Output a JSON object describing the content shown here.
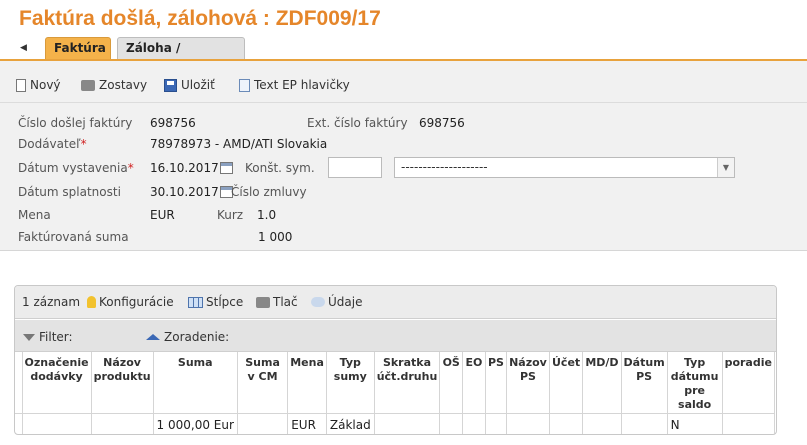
{
  "page": {
    "title": "Faktúra došlá, zálohová :  ZDF009/17",
    "back_glyph": "◀",
    "tabs": [
      "Faktúra",
      "Záloha / Dobropis"
    ]
  },
  "toolbar": {
    "new": "Nový",
    "reports": "Zostavy",
    "save": "Uložiť",
    "ep_header": "Text EP hlavičky"
  },
  "form": {
    "invoice_no_label": "Číslo došlej faktúry",
    "invoice_no": "698756",
    "ext_no_label": "Ext. číslo faktúry",
    "ext_no": "698756",
    "supplier_label": "Dodávateľ",
    "supplier": "78978973 - AMD/ATI Slovakia",
    "issue_date_label": "Dátum vystavenia",
    "issue_date": "16.10.2017",
    "const_sym_label": "Konšt. sym.",
    "const_sym": "",
    "const_sym_select": "--------------------",
    "due_date_label": "Dátum splatnosti",
    "due_date": "30.10.2017",
    "contract_label": "Číslo zmluvy",
    "currency_label": "Mena",
    "currency": "EUR",
    "rate_label": "Kurz",
    "rate": "1.0",
    "amount_label": "Faktúrovaná suma",
    "amount": "1 000",
    "required_mark": "*"
  },
  "grid": {
    "record_count": "1 záznam",
    "configuration": "Konfigurácie",
    "columns_btn": "Stĺpce",
    "print_btn": "Tlač",
    "data_btn": "Údaje",
    "filter_label": "Filter:",
    "sort_label": "Zoradenie:",
    "columns": [
      "Označenie dodávky",
      "Názov produktu",
      "Suma",
      "Suma v CM",
      "Mena",
      "Typ sumy",
      "Skratka účt.druhu",
      "OŠ",
      "EO",
      "PS",
      "Názov PS",
      "Účet",
      "MD/D",
      "Dátum PS",
      "Typ dátumu pre saldo",
      "poradie"
    ],
    "rows": [
      [
        "",
        "",
        "1 000,00 Eur",
        "",
        "EUR",
        "Základ",
        "",
        "",
        "",
        "",
        "",
        "",
        "",
        "",
        "N",
        ""
      ]
    ]
  }
}
